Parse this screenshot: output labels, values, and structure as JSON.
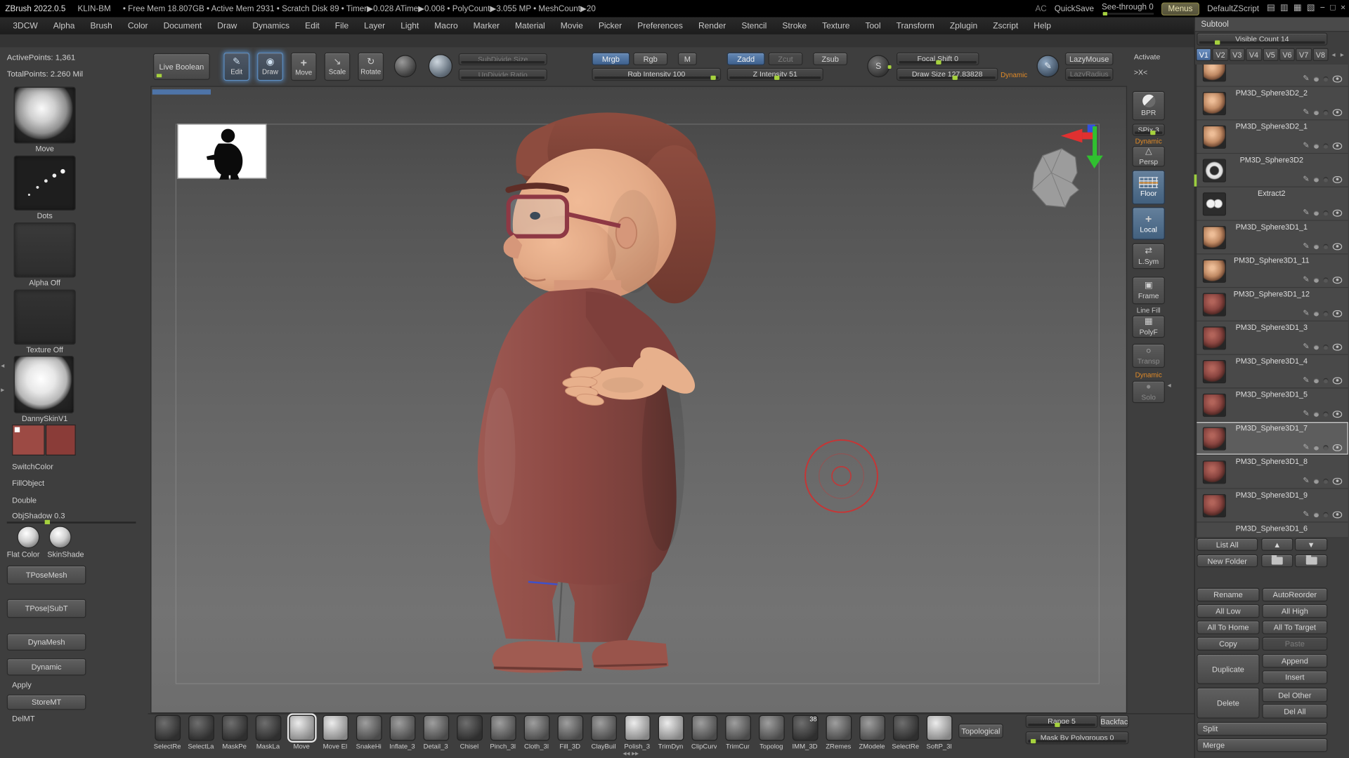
{
  "accent": {
    "active_blue": "#4a6d9c",
    "slider_green": "#a6d23e",
    "dynamic_orange": "#e08a28",
    "cursor_red": "#d03030"
  },
  "titlebar": {
    "app": "ZBrush 2022.0.5",
    "machine": "KLIN-BM",
    "stats": "• Free Mem 18.807GB • Active Mem 2931 • Scratch Disk 89 •  Timer▶0.028 ATime▶0.008 • PolyCount▶3.055 MP  • MeshCount▶20",
    "ac": "AC",
    "quicksave": "QuickSave",
    "see_through": "See-through 0",
    "menus": "Menus",
    "default_zscript": "DefaultZScript",
    "window_icons": [
      "▤",
      "▥",
      "▦",
      "▧",
      "−",
      "□",
      "×"
    ]
  },
  "menubar": {
    "items": [
      "3DCW",
      "Alpha",
      "Brush",
      "Color",
      "Document",
      "Draw",
      "Dynamics",
      "Edit",
      "File",
      "Layer",
      "Light",
      "Macro",
      "Marker",
      "Material",
      "Movie",
      "Picker",
      "Preferences",
      "Render",
      "Stencil",
      "Stroke",
      "Texture",
      "Tool",
      "Transform",
      "Zplugin",
      "Zscript",
      "Help"
    ]
  },
  "icons": {
    "edit": "✎",
    "draw": "◉",
    "move": "+",
    "scale": "↘",
    "rotate": "↻",
    "s_badge": "S",
    "lazy": "✎",
    "persp": "△",
    "local": "+",
    "lsym": "⇄",
    "frame": "▣",
    "polyf": "▦",
    "transp": "○",
    "solo": "●",
    "up": "▲",
    "down": "▼",
    "tab_prev": "◂",
    "tab_next": "▸",
    "left_collapse": "◂",
    "left_expand": "▸",
    "right_collapse": "◂",
    "bottom_handle": "◂◂ ▸▸"
  },
  "topshelf": {
    "live_boolean": "Live Boolean",
    "edit": "Edit",
    "draw": "Draw",
    "move": "Move",
    "scale": "Scale",
    "rotate": "Rotate",
    "subdivide_size": "SubDivide Size",
    "undivide_ratio": "UnDivide Ratio",
    "mrgb": "Mrgb",
    "rgb": "Rgb",
    "m": "M",
    "rgb_intensity": "Rgb Intensity 100",
    "zadd": "Zadd",
    "zcut": "Zcut",
    "zsub": "Zsub",
    "z_intensity": "Z Intensity 51",
    "focal_shift": "Focal Shift 0",
    "draw_size": "Draw Size 127.83828",
    "dynamic": "Dynamic",
    "lazymouse": "LazyMouse",
    "lazyradius": "LazyRadius"
  },
  "lefttray": {
    "active_points": "ActivePoints: 1,361",
    "total_points": "TotalPoints: 2.260 Mil",
    "brush_label": "Move",
    "stroke_label": "Dots",
    "alpha_label": "Alpha Off",
    "texture_label": "Texture Off",
    "material_label": "DannySkinV1",
    "switch_color": "SwitchColor",
    "fill_object": "FillObject",
    "double": "Double",
    "obj_shadow": "ObjShadow 0.3",
    "flat_color": "Flat Color",
    "skin_shade": "SkinShade",
    "tpose_mesh": "TPoseMesh",
    "tpose_subt": "TPose|SubT",
    "dynamesh": "DynaMesh",
    "dynamic": "Dynamic",
    "apply": "Apply",
    "store_mt": "StoreMT",
    "del_mt": "DelMT"
  },
  "rightshelf": {
    "activate": "Activate",
    "activate_sym": ">X<",
    "bpr": "BPR",
    "spix": "SPix 3",
    "dynamic_persp": "Dynamic",
    "persp": "Persp",
    "floor": "Floor",
    "local": "Local",
    "lsym": "L.Sym",
    "frame": "Frame",
    "line_fill": "Line Fill",
    "polyf": "PolyF",
    "transp": "Transp",
    "dynamic_solo": "Dynamic",
    "solo": "Solo"
  },
  "subtool": {
    "title": "Subtool",
    "visible_count": "Visible Count 14",
    "tabs": [
      {
        "label": "V1",
        "state": "active"
      },
      {
        "label": "V2",
        "state": ""
      },
      {
        "label": "V3",
        "state": ""
      },
      {
        "label": "V4",
        "state": ""
      },
      {
        "label": "V5",
        "state": ""
      },
      {
        "label": "V6",
        "state": ""
      },
      {
        "label": "V7",
        "state": ""
      },
      {
        "label": "V8",
        "state": ""
      }
    ],
    "items": [
      {
        "name": "",
        "thumb": "t-tan",
        "state": "partial"
      },
      {
        "name": "PM3D_Sphere3D2_2",
        "thumb": "t-tan",
        "state": ""
      },
      {
        "name": "PM3D_Sphere3D2_1",
        "thumb": "t-tan",
        "state": ""
      },
      {
        "name": "PM3D_Sphere3D2",
        "thumb": "t-ring",
        "state": ""
      },
      {
        "name": "Extract2",
        "thumb": "t-eyes",
        "state": ""
      },
      {
        "name": "PM3D_Sphere3D1_1",
        "thumb": "t-tan",
        "state": ""
      },
      {
        "name": "PM3D_Sphere3D1_11",
        "thumb": "t-tan",
        "state": ""
      },
      {
        "name": "PM3D_Sphere3D1_12",
        "thumb": "t-red",
        "state": ""
      },
      {
        "name": "PM3D_Sphere3D1_3",
        "thumb": "t-red",
        "state": ""
      },
      {
        "name": "PM3D_Sphere3D1_4",
        "thumb": "t-red",
        "state": ""
      },
      {
        "name": "PM3D_Sphere3D1_5",
        "thumb": "t-red",
        "state": ""
      },
      {
        "name": "PM3D_Sphere3D1_7",
        "thumb": "t-red",
        "state": "selected"
      },
      {
        "name": "PM3D_Sphere3D1_8",
        "thumb": "t-red",
        "state": ""
      },
      {
        "name": "PM3D_Sphere3D1_9",
        "thumb": "t-red",
        "state": ""
      },
      {
        "name": "PM3D_Sphere3D1_6",
        "thumb": "t-red",
        "state": "cut"
      }
    ],
    "list_all": "List All",
    "new_folder": "New Folder",
    "rename": "Rename",
    "autoreorder": "AutoReorder",
    "all_low": "All Low",
    "all_high": "All High",
    "all_to_home": "All To Home",
    "all_to_target": "All To Target",
    "copy": "Copy",
    "paste": "Paste",
    "duplicate": "Duplicate",
    "append": "Append",
    "insert": "Insert",
    "delete": "Delete",
    "del_other": "Del Other",
    "del_all": "Del All",
    "split": "Split",
    "merge": "Merge"
  },
  "bottomshelf": {
    "brushes": [
      {
        "label": "SelectRe",
        "tone": "tone-dark",
        "state": ""
      },
      {
        "label": "SelectLa",
        "tone": "tone-dark",
        "state": ""
      },
      {
        "label": "MaskPe",
        "tone": "tone-dark",
        "state": ""
      },
      {
        "label": "MaskLa",
        "tone": "tone-dark",
        "state": ""
      },
      {
        "label": "Move",
        "tone": "tone-light",
        "state": "selected"
      },
      {
        "label": "Move El",
        "tone": "tone-light",
        "state": ""
      },
      {
        "label": "SnakeHi",
        "tone": "tone-mid",
        "state": ""
      },
      {
        "label": "Inflate_3",
        "tone": "tone-mid",
        "state": ""
      },
      {
        "label": "Detail_3",
        "tone": "tone-mid",
        "state": ""
      },
      {
        "label": "Chisel",
        "tone": "tone-dark",
        "state": ""
      },
      {
        "label": "Pinch_3l",
        "tone": "tone-mid",
        "state": ""
      },
      {
        "label": "Cloth_3l",
        "tone": "tone-mid",
        "state": ""
      },
      {
        "label": "Fill_3D",
        "tone": "tone-mid",
        "state": ""
      },
      {
        "label": "ClayBuil",
        "tone": "tone-mid",
        "state": ""
      },
      {
        "label": "Polish_3",
        "tone": "tone-light",
        "state": ""
      },
      {
        "label": "TrimDyn",
        "tone": "tone-light",
        "state": ""
      },
      {
        "label": "ClipCurv",
        "tone": "tone-mid",
        "state": ""
      },
      {
        "label": "TrimCur",
        "tone": "tone-mid",
        "state": ""
      },
      {
        "label": "Topolog",
        "tone": "tone-mid",
        "state": ""
      },
      {
        "label": "IMM_3D",
        "tone": "tone-dark",
        "badge": "38",
        "state": ""
      },
      {
        "label": "ZRemes",
        "tone": "tone-mid",
        "state": ""
      },
      {
        "label": "ZModele",
        "tone": "tone-mid",
        "state": ""
      },
      {
        "label": "SelectRe",
        "tone": "tone-dark",
        "state": ""
      },
      {
        "label": "SoftP_3l",
        "tone": "tone-light",
        "state": ""
      }
    ],
    "topological": "Topological",
    "range": "Range 5",
    "backface": "Backfac",
    "mask_by_polygroups": "Mask By Polygroups 0"
  }
}
